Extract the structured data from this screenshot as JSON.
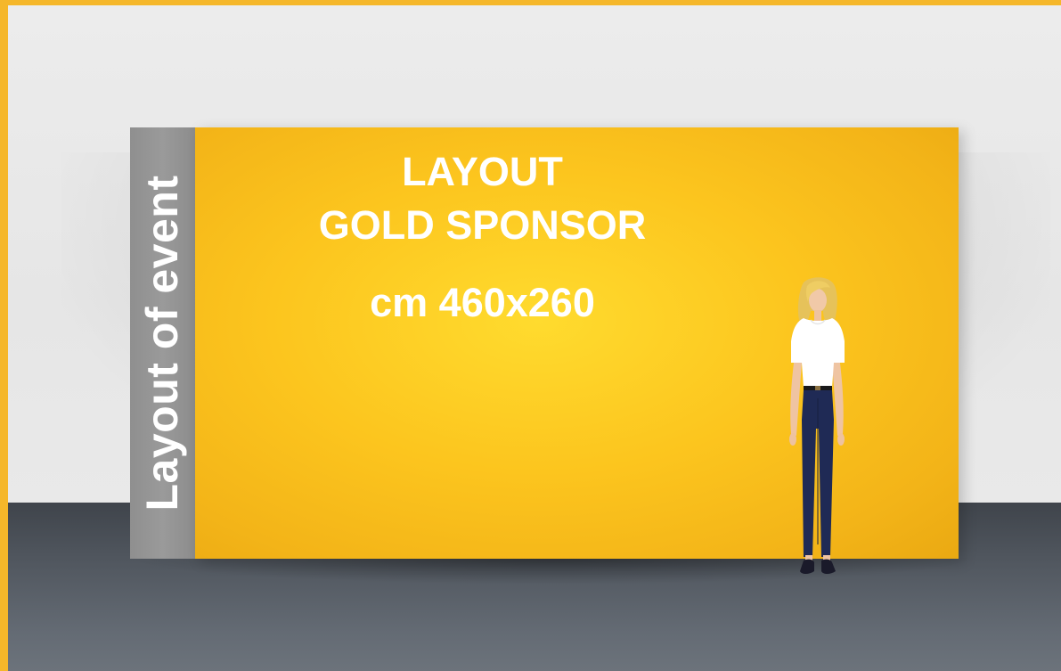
{
  "side_panel": {
    "label": "Layout of event"
  },
  "banner": {
    "line1": "LAYOUT",
    "line2": "GOLD SPONSOR",
    "line3": "cm 460x260"
  },
  "colors": {
    "accent_border": "#f5b72a",
    "banner_yellow": "#fcc51e",
    "side_panel_gray": "#969696",
    "floor": "#555b63",
    "wall": "#e8e8e8"
  }
}
